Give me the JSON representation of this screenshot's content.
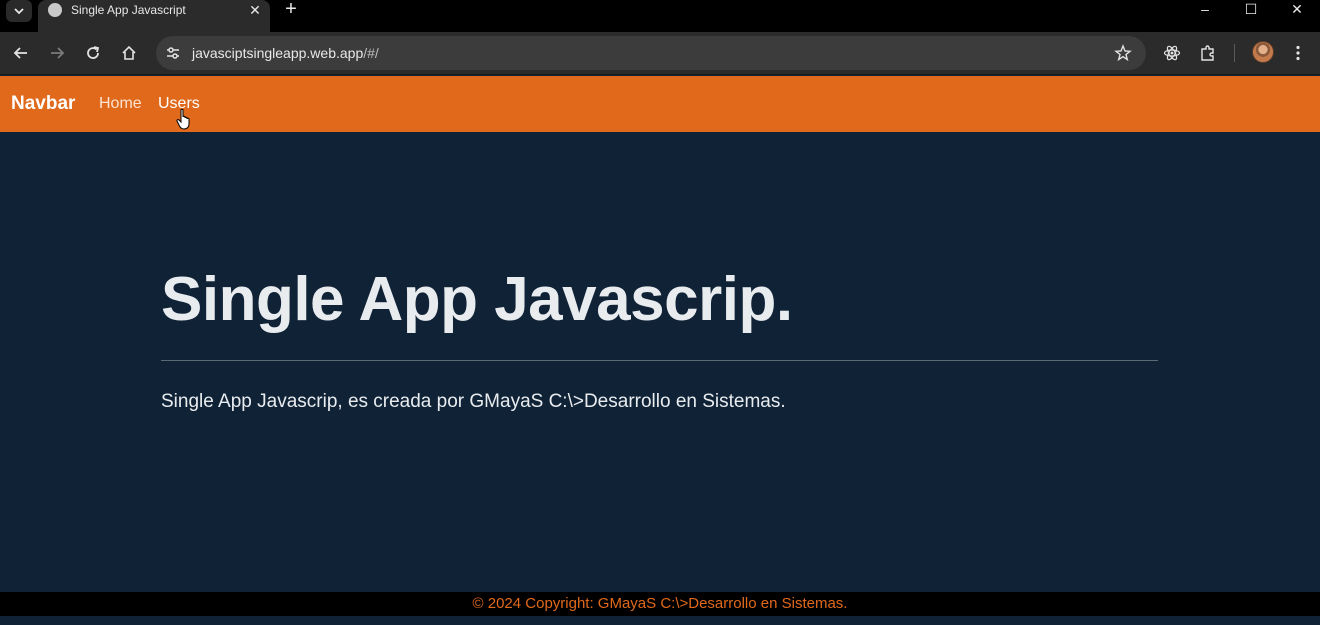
{
  "browser": {
    "tab": {
      "title": "Single App Javascript"
    },
    "address": {
      "host": "javasciptsingleapp.web.app",
      "path": "/#/"
    }
  },
  "navbar": {
    "brand": "Navbar",
    "links": [
      {
        "label": "Home"
      },
      {
        "label": "Users"
      }
    ]
  },
  "hero": {
    "title": "Single App Javascrip.",
    "text": "Single App Javascrip, es creada por GMayaS C:\\>Desarrollo en Sistemas."
  },
  "footer": {
    "text": "© 2024 Copyright: GMayaS C:\\>Desarrollo en Sistemas."
  },
  "colors": {
    "navbar_bg": "#e0691b",
    "page_bg": "#0f2236",
    "footer_text": "#e0691b"
  }
}
